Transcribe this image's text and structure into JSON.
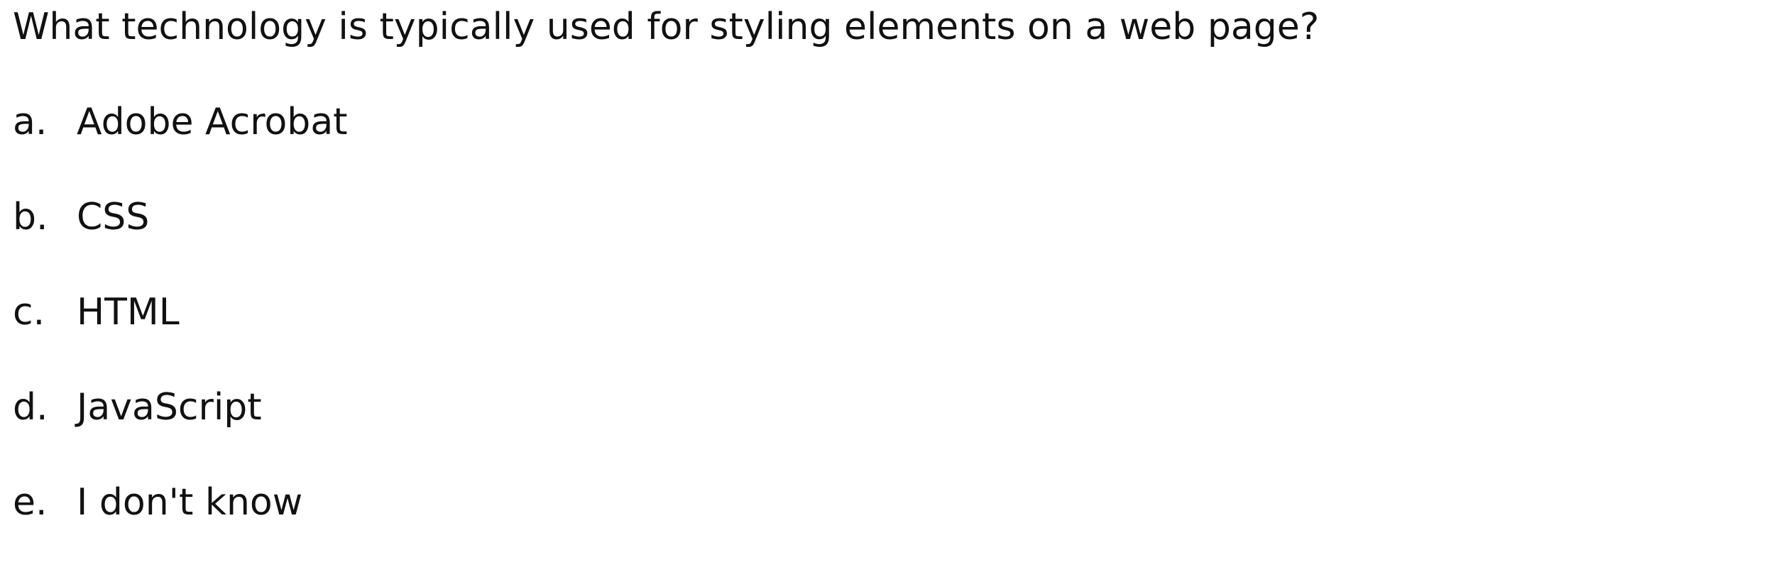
{
  "question": {
    "text": "What technology is typically used for styling elements on a web page?"
  },
  "options": [
    {
      "letter": "a.",
      "text": "Adobe Acrobat"
    },
    {
      "letter": "b.",
      "text": "CSS"
    },
    {
      "letter": "c.",
      "text": "HTML"
    },
    {
      "letter": "d.",
      "text": "JavaScript"
    },
    {
      "letter": "e.",
      "text": "I don't know"
    }
  ]
}
